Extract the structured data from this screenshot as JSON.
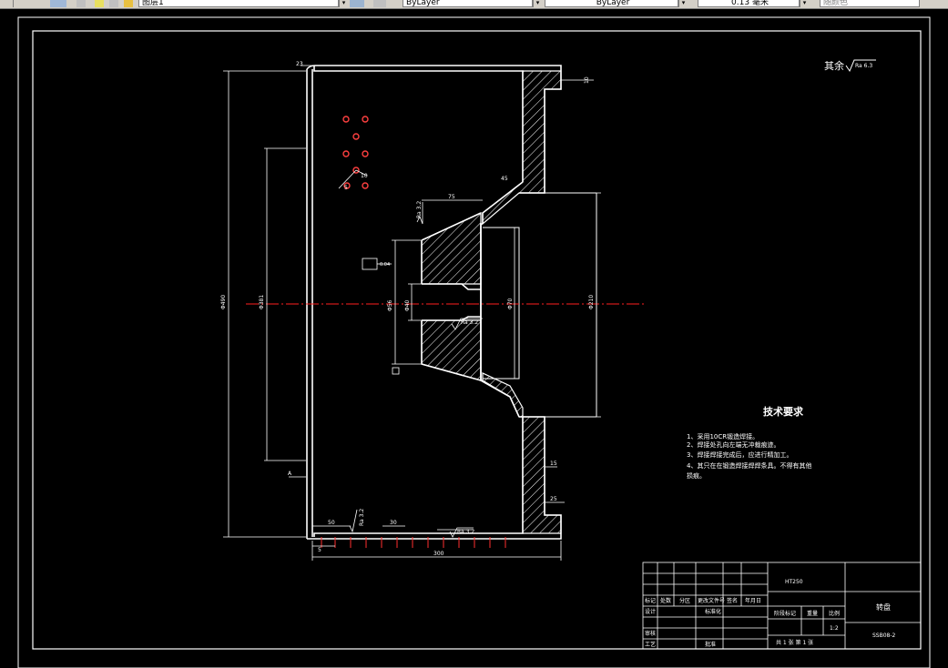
{
  "toolbar": {
    "layer_name": "图层1",
    "color_combo": "ByLayer",
    "linetype_combo": "ByLayer",
    "lineweight_combo": "0.13 毫米",
    "plotstyle_combo": "随颜色"
  },
  "drawing": {
    "surface_note_label": "其余",
    "surface_note_value": "Ra 6.3",
    "tech_req_title": "技术要求",
    "tech_req_items": [
      "1、采用10CR锻造焊接。",
      "2、焊接处孔向左端无冲裁痕迹。",
      "3、焊接焊接完成后，应进行精加工。",
      "4、其只在在锻造焊接焊焊条具。不得有其他"
    ],
    "tech_req_item4_cont": "损痕。",
    "ra_32_a": "Ra 3.2",
    "ra_32_b": "Ra 3.2",
    "ra_32_c": "Ra 3.2",
    "ra_32_d": "Ra 3.2",
    "dims": {
      "overall_width": "300",
      "left_height": "Φ490",
      "inner_d1": "Φ381",
      "inner_d2": "Φ56",
      "inner_d3": "Φ70",
      "inner_d4": "Φ210",
      "dia_40": "Φ40",
      "dim_5": "5",
      "dim_75": "75",
      "dim_15": "15",
      "dim_25": "25",
      "dim_50": "50",
      "dim_30": "30",
      "dim_23": "23",
      "dim_45": "45",
      "dim_10": "10",
      "frame_label": "0.04",
      "datum_a": "A"
    },
    "title_block": {
      "col_mark": "标记",
      "col_count": "处数",
      "col_zone": "分区",
      "col_file": "更改文件号",
      "col_sign": "签名",
      "col_date": "年月日",
      "row_design": "设计",
      "row_std": "标准化",
      "row_check": "审核",
      "row_process": "工艺",
      "row_approve": "批准",
      "material": "HT250",
      "stage_mark": "阶段标记",
      "weight": "重量",
      "scale": "比例",
      "scale_val": "1:2",
      "sheet": "共 1 张 第 1 张",
      "part_name": "转盘",
      "drawing_no": "SSB08-2"
    }
  }
}
